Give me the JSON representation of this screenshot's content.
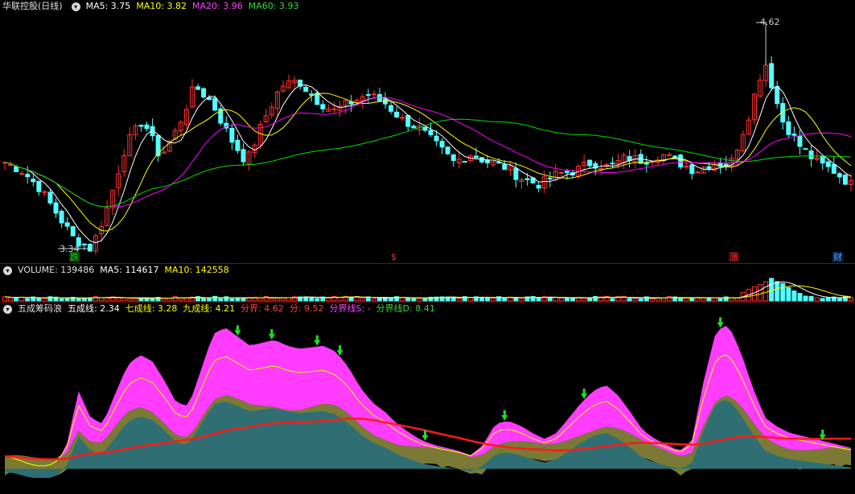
{
  "colors": {
    "up": "#ff3232",
    "down": "#54ffff",
    "ma5": "#ffffff",
    "ma10": "#ffff00",
    "ma20": "#ff00ff",
    "ma60": "#00e000",
    "olive": "#7a7a35",
    "teal": "#2f6f73",
    "magenta": "#ff3cff",
    "red_line": "#ff1a1a",
    "border": "#7a1010"
  },
  "price_panel": {
    "stock_name": "华联控股(日线)",
    "ma5_label": "MA5: 3.75",
    "ma10_label": "MA10: 3.82",
    "ma20_label": "MA20: 3.96",
    "ma60_label": "MA60: 3.93",
    "high_marker": "4.62",
    "low_marker": "3.34",
    "events": [
      {
        "label": "跌",
        "color": "#00e000"
      },
      {
        "label": "$",
        "color": "#ff3030"
      },
      {
        "label": "涨",
        "color": "#ff3030"
      },
      {
        "label": "财",
        "color": "#4aa0ff"
      }
    ]
  },
  "volume_panel": {
    "volume_label": "VOLUME: 139486",
    "ma5_label": "MA5: 114617",
    "ma10_label": "MA10: 142558"
  },
  "indicator_panel": {
    "name": "五成筹码浪",
    "five_label": "五成线: 2.34",
    "seven_label": "七成线: 3.28",
    "nine_label": "九成线: 4.21",
    "boundary_label": "分界: 4.62",
    "fen_label": "分: 9.52",
    "boundary_s_label": "分界线S: -",
    "boundary_d_label": "分界线D: 8.41"
  },
  "chart_data": [
    {
      "type": "candlestick",
      "title": "华联控股(日线)",
      "ylim": [
        3.3,
        4.7
      ],
      "annotations": {
        "max": 4.62,
        "min": 3.34
      },
      "ohlc_sample_points": [
        {
          "close": 3.85
        },
        {
          "close": 3.8
        },
        {
          "close": 3.7
        },
        {
          "close": 3.55
        },
        {
          "close": 3.4
        },
        {
          "close": 3.34
        },
        {
          "close": 3.6
        },
        {
          "close": 3.95
        },
        {
          "close": 4.1
        },
        {
          "close": 3.88
        },
        {
          "close": 4.05
        },
        {
          "close": 4.3
        },
        {
          "close": 4.2
        },
        {
          "close": 4.0
        },
        {
          "close": 3.85
        },
        {
          "close": 4.1
        },
        {
          "close": 4.3
        },
        {
          "close": 4.33
        },
        {
          "close": 4.22
        },
        {
          "close": 4.15
        },
        {
          "close": 4.2
        },
        {
          "close": 4.25
        },
        {
          "close": 4.2
        },
        {
          "close": 4.1
        },
        {
          "close": 4.05
        },
        {
          "close": 3.95
        },
        {
          "close": 3.85
        },
        {
          "close": 3.9
        },
        {
          "close": 3.85
        },
        {
          "close": 3.82
        },
        {
          "close": 3.75
        },
        {
          "close": 3.72
        },
        {
          "close": 3.78
        },
        {
          "close": 3.8
        },
        {
          "close": 3.85
        },
        {
          "close": 3.82
        },
        {
          "close": 3.88
        },
        {
          "close": 3.86
        },
        {
          "close": 3.9
        },
        {
          "close": 3.85
        },
        {
          "close": 3.8
        },
        {
          "close": 3.85
        },
        {
          "close": 3.83
        },
        {
          "close": 4.1
        },
        {
          "close": 4.45
        },
        {
          "close": 4.1
        },
        {
          "close": 3.95
        },
        {
          "close": 3.85
        },
        {
          "close": 3.8
        },
        {
          "close": 3.72
        }
      ],
      "series": [
        {
          "name": "MA5",
          "last": 3.75
        },
        {
          "name": "MA10",
          "last": 3.82
        },
        {
          "name": "MA20",
          "last": 3.96
        },
        {
          "name": "MA60",
          "last": 3.93
        }
      ]
    },
    {
      "type": "bar",
      "title": "VOLUME",
      "series": [
        {
          "name": "VOLUME",
          "last": 139486
        },
        {
          "name": "MA5",
          "last": 114617
        },
        {
          "name": "MA10",
          "last": 142558
        }
      ]
    },
    {
      "type": "area",
      "title": "五成筹码浪",
      "series": [
        {
          "name": "五成线",
          "last": 2.34
        },
        {
          "name": "七成线",
          "last": 3.28
        },
        {
          "name": "九成线",
          "last": 4.21
        },
        {
          "name": "分界",
          "last": 4.62
        },
        {
          "name": "分",
          "last": 9.52
        },
        {
          "name": "分界线D",
          "last": 8.41
        }
      ],
      "wave_profile": [
        1.5,
        1.2,
        0.8,
        0.6,
        0.8,
        2.0,
        5.8,
        4.0,
        3.6,
        5.6,
        7.5,
        8.2,
        7.8,
        6.5,
        5.0,
        4.8,
        7.2,
        9.6,
        10.0,
        9.4,
        8.8,
        9.0,
        9.2,
        8.8,
        8.6,
        8.7,
        8.8,
        8.4,
        7.4,
        6.0,
        5.0,
        4.4,
        3.6,
        3.0,
        2.5,
        2.2,
        2.0,
        1.8,
        1.5,
        2.2,
        3.6,
        3.8,
        3.5,
        3.0,
        2.6,
        3.0,
        4.0,
        5.0,
        5.8,
        6.2,
        5.5,
        4.4,
        3.2,
        2.6,
        2.2,
        1.8,
        2.4,
        6.5,
        9.8,
        10.2,
        8.4,
        6.0,
        4.0,
        3.4,
        3.0,
        2.8,
        2.6,
        2.4,
        2.2,
        2.0
      ]
    }
  ]
}
